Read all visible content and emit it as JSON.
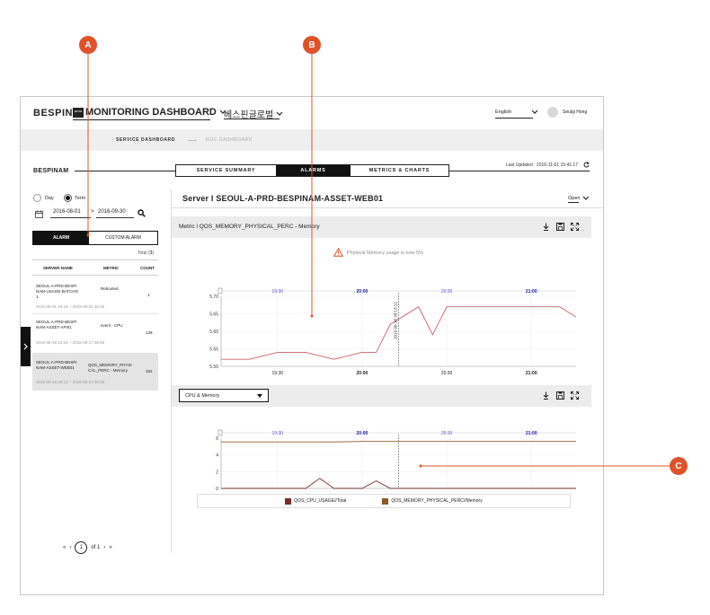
{
  "header": {
    "brand": "BESPIN",
    "logo_badge": "ᄆᄆ",
    "title": "MONITORING DASHBOARD",
    "org_select": "베스핀글로벌",
    "language": "English",
    "user_name": "Seulgi Hong"
  },
  "subnav": {
    "items": [
      "SERVICE DASHBOARD",
      "NOC DASHBOARD"
    ]
  },
  "section": {
    "name": "BESPINAM",
    "tabs": [
      "SERVICE SUMMARY",
      "ALARMS",
      "METRICS & CHARTS"
    ],
    "last_updated": "Last Updated : 2016-11-01 15:41:17"
  },
  "sidebar": {
    "radio_day": "Day",
    "radio_term": "Term",
    "date_from": "2016-08-01",
    "date_sep": ">",
    "date_to": "2016-09-30",
    "tabs": [
      "ALARM",
      "CUSTOM ALARM"
    ],
    "total_label": "Total",
    "total_count": "3",
    "columns": [
      "SERVER NAME",
      "METRIC",
      "COUNT"
    ],
    "rows": [
      {
        "server": [
          "SEOUL-A-PRD-BESPI",
          "NAM-USAGE-BATCHO",
          "1"
        ],
        "metric": [
          "Rebooted"
        ],
        "count": "1",
        "range": "2016-08-31 19:19 ~ 2016-09-02 15:46"
      },
      {
        "server": [
          "SEOUL-A-PRD-BESPI",
          "NAM-ASSET-API01"
        ],
        "metric": [
          "event - CPU"
        ],
        "count": "139",
        "range": "2016-08-16 21:18 ~ 2016-08-17 08:49"
      },
      {
        "server": [
          "SEOUL-A-PRD-BESPI",
          "NAM-ASSET-WEB01"
        ],
        "metric": [
          "QOS_MEMORY_PHYSI",
          "CAL_PERC - Memory"
        ],
        "count": "152",
        "range": "2016-08-16 20:13 ~ 2016-08-17 08:49"
      }
    ],
    "pagination": {
      "current": "1",
      "of": "of 1"
    }
  },
  "main": {
    "server_title": "Server l SEOUL-A-PRD-BESPINAM-ASSET-WEB01",
    "open_label": "Open",
    "metric_title": "Metric l QOS_MEMORY_PHYSICAL_PERC - Memory",
    "warning": "Physical Memory usage is now 5%",
    "select_value": "CPU & Memory"
  },
  "annotations": {
    "a": "A",
    "b": "B",
    "c": "C"
  },
  "colors": {
    "accent": "#e0532a",
    "cpu": "#7a2e2e",
    "memory": "#8a5a2b",
    "line1": "#c9606b"
  },
  "chart_data": [
    {
      "type": "line",
      "title": "",
      "x": [
        "19:10",
        "19:20",
        "19:30",
        "19:40",
        "19:50",
        "20:00",
        "20:05",
        "20:10",
        "20:20",
        "20:25",
        "20:30",
        "20:40",
        "20:50",
        "21:00",
        "21:05",
        "21:10",
        "21:20"
      ],
      "series": [
        {
          "values": [
            5.52,
            5.52,
            5.54,
            5.54,
            5.52,
            5.54,
            5.54,
            5.62,
            5.67,
            5.59,
            5.67,
            5.67,
            5.67,
            5.67,
            5.67,
            5.67,
            5.62
          ]
        }
      ],
      "ylim": [
        5.5,
        5.7
      ],
      "yticks": [
        "5.70",
        "5.65",
        "5.60",
        "5.55",
        "5.50"
      ],
      "top_ticks": [
        "19:30",
        "20:00",
        "20:30",
        "21:00"
      ],
      "bottom_ticks": [
        "19:30",
        "20:00",
        "20:30",
        "21:00"
      ],
      "marker_label": "2016-08-16 20:13:12"
    },
    {
      "type": "line",
      "title": "",
      "x": [
        "19:10",
        "19:20",
        "19:30",
        "19:40",
        "19:45",
        "19:50",
        "20:00",
        "20:05",
        "20:10",
        "20:20",
        "20:30",
        "20:40",
        "20:50",
        "21:00",
        "21:10",
        "21:20"
      ],
      "series": [
        {
          "name": "QOS_CPU_USAGE//Total",
          "values": [
            0,
            0,
            0,
            0,
            1.2,
            0,
            0,
            0.9,
            0,
            0,
            0,
            0,
            0,
            0,
            0,
            0
          ]
        },
        {
          "name": "QOS_MEMORY_PHYSICAL_PERC//Memory",
          "values": [
            5.55,
            5.55,
            5.55,
            5.55,
            5.55,
            5.55,
            5.6,
            5.6,
            5.6,
            5.6,
            5.6,
            5.6,
            5.6,
            5.6,
            5.6,
            5.6
          ]
        }
      ],
      "ylim": [
        0,
        6
      ],
      "yticks": [
        "6",
        "4",
        "2",
        "0"
      ],
      "top_ticks": [
        "19:30",
        "20:00",
        "20:30",
        "21:00"
      ],
      "bottom_ticks": [
        "19:30",
        "20:00",
        "20:30",
        "21:00"
      ]
    }
  ]
}
